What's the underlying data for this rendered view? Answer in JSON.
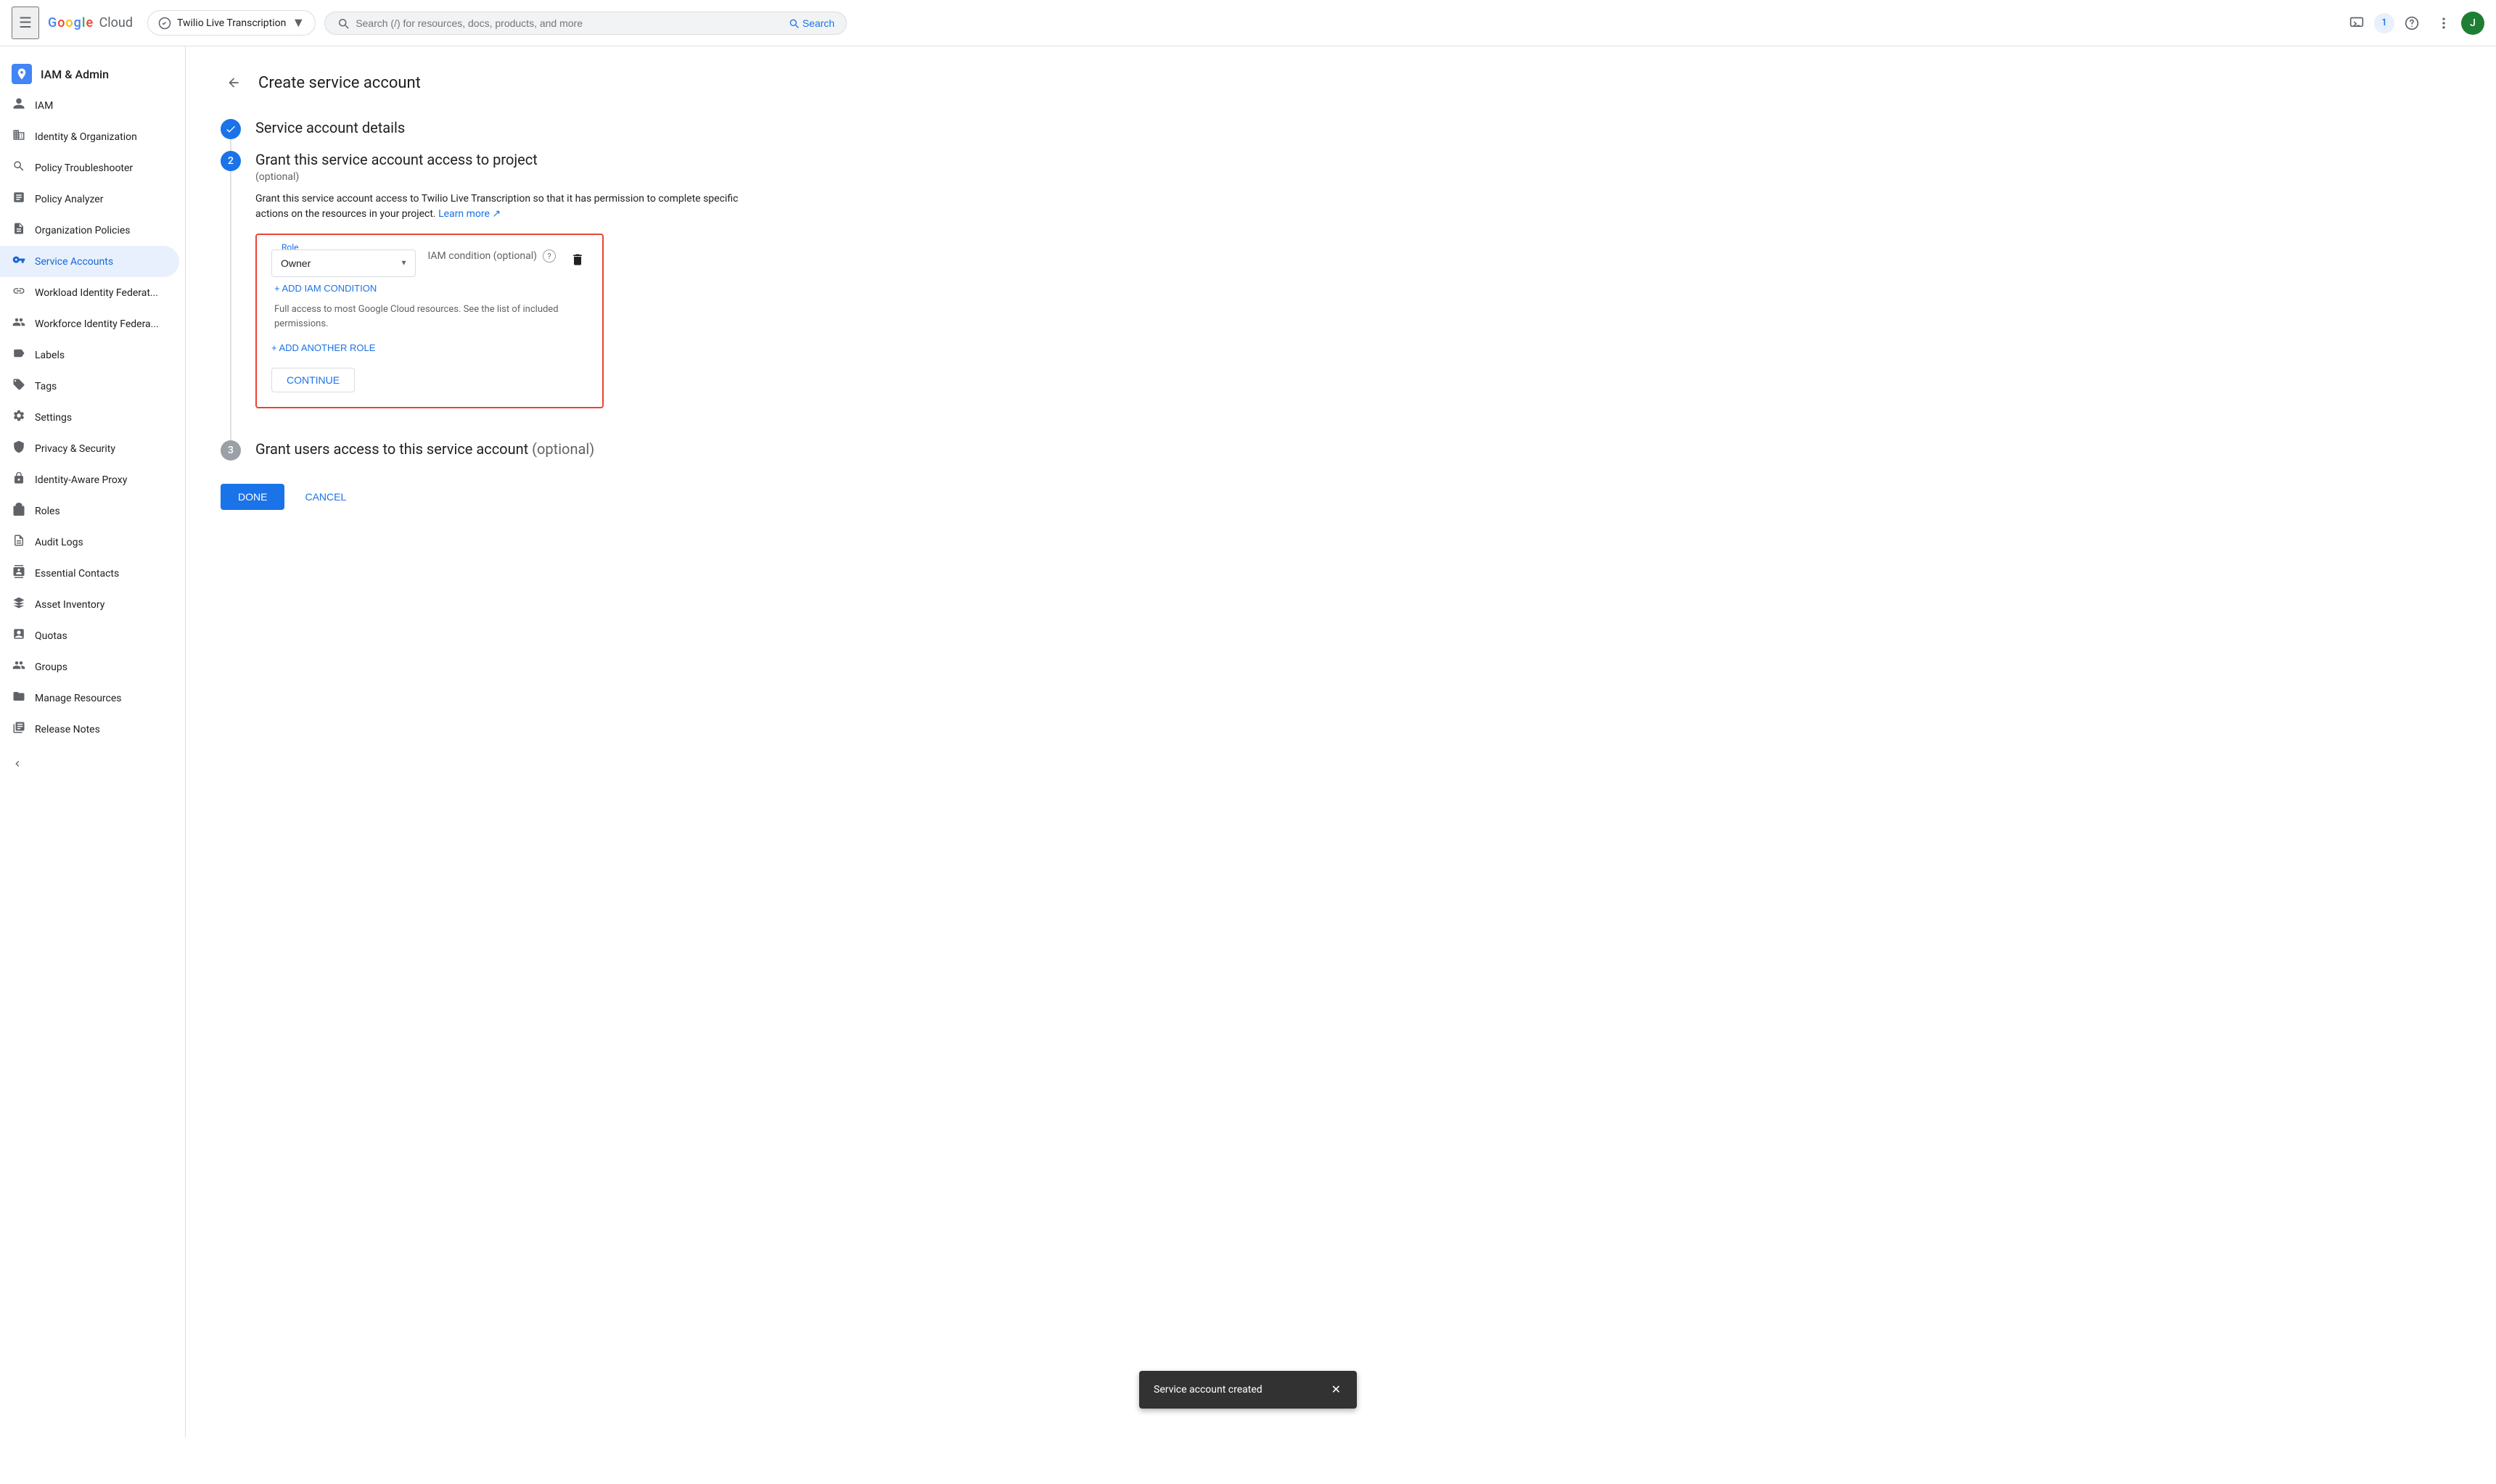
{
  "header": {
    "menu_label": "☰",
    "google_text": "Google",
    "cloud_text": "Cloud",
    "project_name": "Twilio Live Transcription",
    "project_arrow": "▼",
    "search_placeholder": "Search (/) for resources, docs, products, and more",
    "search_label": "Search",
    "notification_count": "1",
    "avatar_letter": "J"
  },
  "sidebar": {
    "header_title": "IAM & Admin",
    "items": [
      {
        "id": "iam",
        "label": "IAM",
        "icon": "👤",
        "active": false
      },
      {
        "id": "identity-org",
        "label": "Identity & Organization",
        "icon": "🏢",
        "active": false
      },
      {
        "id": "policy-troubleshooter",
        "label": "Policy Troubleshooter",
        "icon": "🔧",
        "active": false
      },
      {
        "id": "policy-analyzer",
        "label": "Policy Analyzer",
        "icon": "📋",
        "active": false
      },
      {
        "id": "org-policies",
        "label": "Organization Policies",
        "icon": "📝",
        "active": false
      },
      {
        "id": "service-accounts",
        "label": "Service Accounts",
        "icon": "🔑",
        "active": true
      },
      {
        "id": "workload-identity-fed",
        "label": "Workload Identity Federat...",
        "icon": "🔗",
        "active": false
      },
      {
        "id": "workforce-identity-fed",
        "label": "Workforce Identity Federa...",
        "icon": "👥",
        "active": false
      },
      {
        "id": "labels",
        "label": "Labels",
        "icon": "🏷️",
        "active": false
      },
      {
        "id": "tags",
        "label": "Tags",
        "icon": "🔖",
        "active": false
      },
      {
        "id": "settings",
        "label": "Settings",
        "icon": "⚙️",
        "active": false
      },
      {
        "id": "privacy-security",
        "label": "Privacy & Security",
        "icon": "🛡️",
        "active": false
      },
      {
        "id": "identity-aware-proxy",
        "label": "Identity-Aware Proxy",
        "icon": "🔒",
        "active": false
      },
      {
        "id": "roles",
        "label": "Roles",
        "icon": "👔",
        "active": false
      },
      {
        "id": "audit-logs",
        "label": "Audit Logs",
        "icon": "📄",
        "active": false
      },
      {
        "id": "essential-contacts",
        "label": "Essential Contacts",
        "icon": "📞",
        "active": false
      },
      {
        "id": "asset-inventory",
        "label": "Asset Inventory",
        "icon": "💎",
        "active": false
      },
      {
        "id": "quotas",
        "label": "Quotas",
        "icon": "📊",
        "active": false
      },
      {
        "id": "groups",
        "label": "Groups",
        "icon": "👨‍👩‍👧",
        "active": false
      },
      {
        "id": "manage-resources",
        "label": "Manage Resources",
        "icon": "📁",
        "active": false
      },
      {
        "id": "release-notes",
        "label": "Release Notes",
        "icon": "📰",
        "active": false
      }
    ],
    "collapse_label": "◀  Collapse"
  },
  "main": {
    "page_title": "Create service account",
    "step1": {
      "title": "Service account details",
      "completed": true
    },
    "step2": {
      "number": "2",
      "title": "Grant this service account access to project",
      "subtitle": "(optional)",
      "description": "Grant this service account access to Twilio Live Transcription so that it has permission to complete specific actions on the resources in your project.",
      "learn_more": "Learn more",
      "role_label": "Role",
      "role_value": "Owner",
      "iam_condition_label": "IAM condition (optional)",
      "add_iam_condition": "+ ADD IAM CONDITION",
      "role_description": "Full access to most Google Cloud resources. See the list of included permissions.",
      "add_another_role": "+ ADD ANOTHER ROLE",
      "continue_label": "CONTINUE"
    },
    "step3": {
      "number": "3",
      "title": "Grant users access to this service account",
      "optional_label": "(optional)"
    },
    "done_label": "DONE",
    "cancel_label": "CANCEL"
  },
  "snackbar": {
    "message": "Service account created",
    "close_icon": "✕"
  }
}
